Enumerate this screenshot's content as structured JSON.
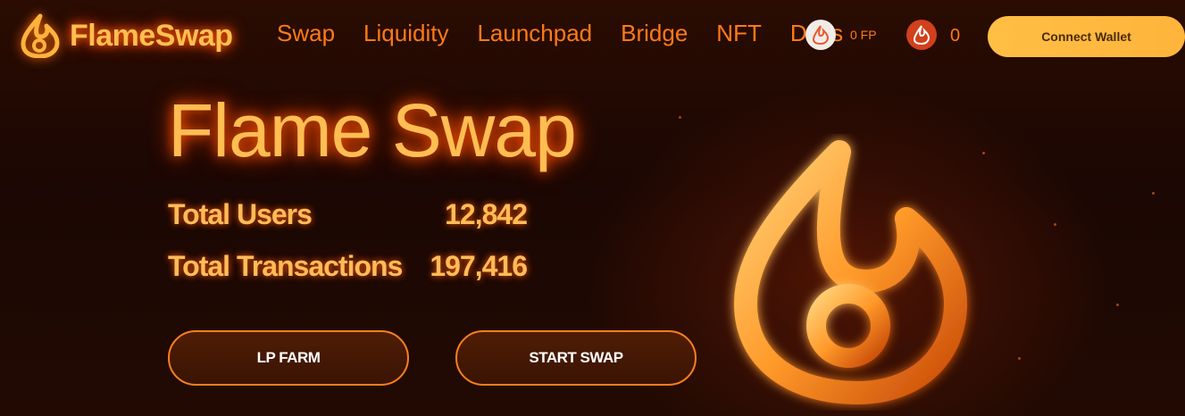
{
  "brand": {
    "name": "FlameSwap"
  },
  "nav": {
    "items": [
      "Swap",
      "Liquidity",
      "Launchpad",
      "Bridge",
      "NFT",
      "Docs"
    ]
  },
  "wallet": {
    "fp_balance": "0 FP",
    "flame_balance": "0",
    "connect_label": "Connect Wallet"
  },
  "hero": {
    "title": "Flame Swap",
    "stats": [
      {
        "label": "Total Users",
        "value": "12,842"
      },
      {
        "label": "Total Transactions",
        "value": "197,416"
      }
    ],
    "buttons": {
      "lp_farm": "LP FARM",
      "start_swap": "START SWAP"
    }
  },
  "colors": {
    "accent": "#ff7a18",
    "title": "#ffbd52",
    "button_bg": "#ffb43b",
    "background": "#1b0703"
  },
  "icons": [
    "flame-logo-icon",
    "fp-token-icon",
    "flame-token-icon",
    "flame-3d-art"
  ]
}
